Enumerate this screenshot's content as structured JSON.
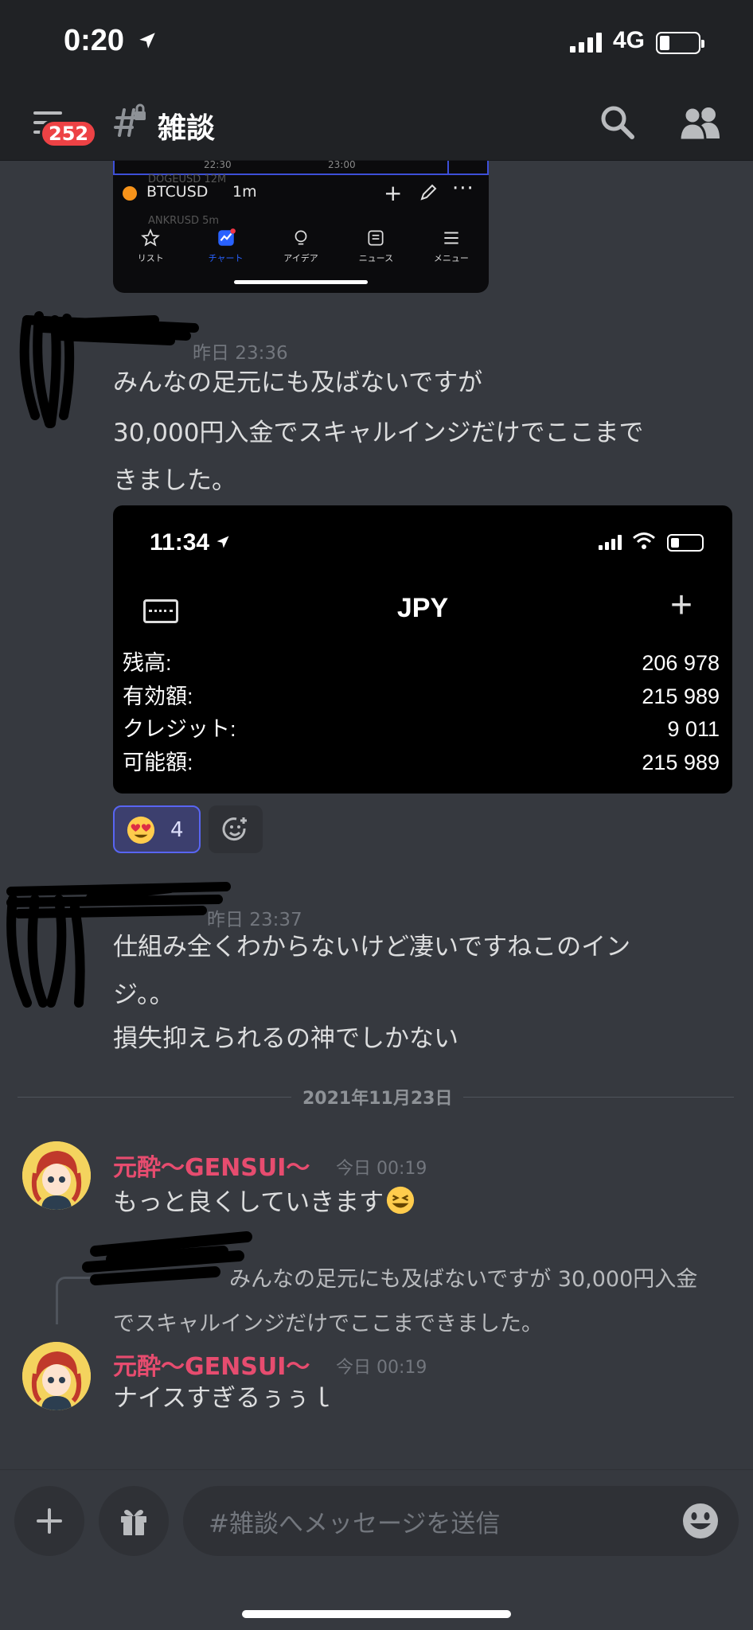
{
  "status_bar": {
    "time": "0:20",
    "network": "4G"
  },
  "header": {
    "badge_count": "252",
    "channel_name": "雑談"
  },
  "tv_screenshot": {
    "time_left": "22:30",
    "time_right": "23:00",
    "ghost_top": "DOGEUSD 12M",
    "ghost_bottom": "ANKRUSD 5m",
    "symbol": "BTCUSD",
    "interval": "1m",
    "nav": [
      "リスト",
      "チャート",
      "アイデア",
      "ニュース",
      "メニュー"
    ]
  },
  "messages": [
    {
      "timestamp": "昨日 23:36",
      "lines": [
        "みんなの足元にも及ばないですが",
        "30,000円入金でスキャルインジだけでここまで\nきました。"
      ]
    },
    {
      "timestamp": "昨日 23:37",
      "lines": [
        "仕組み全くわからないけど凄いですねこのイン\nジ。。",
        "損失抑えられるの神でしかない"
      ]
    }
  ],
  "jpy_screenshot": {
    "time": "11:34",
    "currency": "JPY",
    "rows": [
      {
        "label": "残高:",
        "value": "206 978"
      },
      {
        "label": "有効額:",
        "value": "215 989"
      },
      {
        "label": "クレジット:",
        "value": "9 011"
      },
      {
        "label": "可能額:",
        "value": "215 989"
      }
    ]
  },
  "reaction": {
    "count": "4"
  },
  "date_divider": "2021年11月23日",
  "gensui_messages": [
    {
      "username": "元酔〜GENSUI〜",
      "timestamp": "今日 00:19",
      "text": "もっと良くしていきます"
    },
    {
      "username": "元酔〜GENSUI〜",
      "timestamp": "今日 00:19",
      "text": "ナイスすぎるぅぅｌ"
    }
  ],
  "reply_preview": "みんなの足元にも及ばないですが 30,000円入金でスキャルインジだけでここまできました。",
  "composer": {
    "placeholder": "#雑談へメッセージを送信"
  },
  "colors": {
    "background": "#36393f",
    "header": "#202225",
    "accent": "#5865f2",
    "username": "#e74c6f",
    "badge": "#ed4245"
  }
}
